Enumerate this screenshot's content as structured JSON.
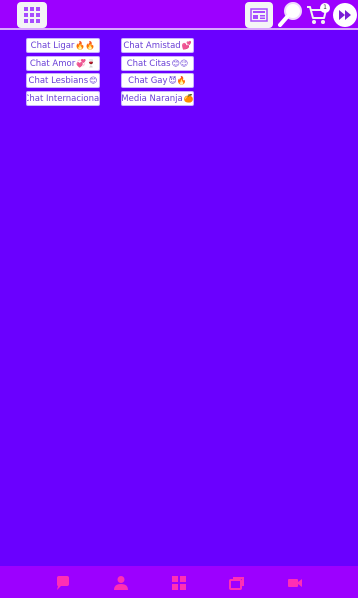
{
  "topbar": {
    "icons": [
      "menu-grid-icon",
      "news-icon",
      "search-icon",
      "cart-icon",
      "forward-arrow-icon"
    ],
    "cart_count": "1"
  },
  "rooms": [
    {
      "label": "Chat Ligar",
      "emoji": "🔥🔥"
    },
    {
      "label": "Chat Amistad",
      "emoji": "💕"
    },
    {
      "label": "Chat Amor",
      "emoji": "💞🍷"
    },
    {
      "label": "Chat Citas",
      "emoji": "😊😉"
    },
    {
      "label": "Chat Lesbians",
      "emoji": "😊"
    },
    {
      "label": "Chat Gay",
      "emoji": "😈🔥"
    },
    {
      "label": "Chat Internacional",
      "emoji": ""
    },
    {
      "label": "Media Naranja",
      "emoji": "🍊"
    }
  ],
  "bottombar": {
    "icons": [
      "chat-icon",
      "user-icon",
      "grid-icon",
      "rooms-icon",
      "video-icon"
    ]
  },
  "colors": {
    "background": "#6a00ff",
    "bar": "#9c00ff",
    "icon_pink": "#ff2fb4"
  }
}
